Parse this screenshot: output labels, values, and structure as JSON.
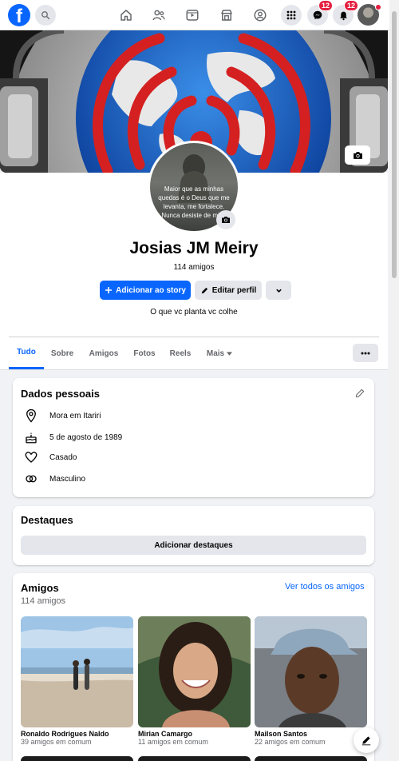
{
  "nav": {
    "messenger_badge": "12",
    "notifications_badge": "12",
    "logo_letter": "f"
  },
  "colors": {
    "accent": "#0866ff",
    "badge": "#e41e3f",
    "background": "#f0f2f5"
  },
  "profile": {
    "name": "Josias JM Meiry",
    "friends": "114 amigos",
    "avatar_quote": "Maior que as minhas quedas é o Deus que me levanta, me fortalece. Nunca desiste de mim.",
    "add_story": "Adicionar ao story",
    "edit_profile": "Editar perfil",
    "bio": "O que vc planta vc colhe"
  },
  "tabs": [
    "Tudo",
    "Sobre",
    "Amigos",
    "Fotos",
    "Reels",
    "Mais"
  ],
  "details": {
    "title": "Dados pessoais",
    "items": [
      {
        "icon": "location-icon",
        "text": "Mora em Itariri"
      },
      {
        "icon": "birthday-cake-icon",
        "text": "5 de agosto de 1989"
      },
      {
        "icon": "heart-icon",
        "text": "Casado"
      },
      {
        "icon": "gender-icon",
        "text": "Masculino"
      }
    ]
  },
  "highlights": {
    "title": "Destaques",
    "button": "Adicionar destaques"
  },
  "friends": {
    "title": "Amigos",
    "count": "114 amigos",
    "see_all": "Ver todos os amigos",
    "list": [
      {
        "name": "Ronaldo Rodrigues Naldo",
        "mutual": "39 amigos em comum"
      },
      {
        "name": "Mirian Camargo",
        "mutual": "11 amigos em comum"
      },
      {
        "name": "Mailson Santos",
        "mutual": "22 amigos em comum"
      }
    ]
  }
}
